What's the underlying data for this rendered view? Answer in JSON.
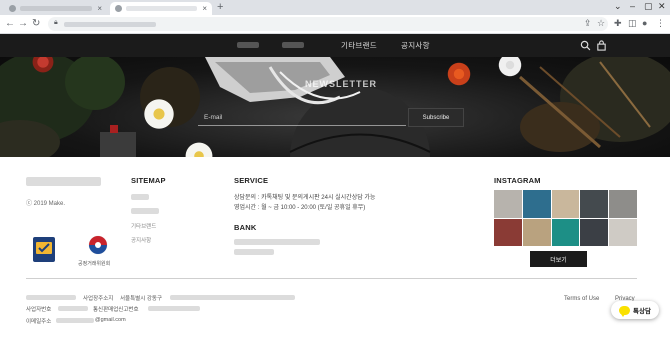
{
  "browser": {
    "tabs": [
      {
        "state": "inactive"
      },
      {
        "state": "active"
      }
    ],
    "new_tab_symbol": "+",
    "close_symbol": "×"
  },
  "header": {
    "menu": [
      "기타브랜드",
      "공지사항"
    ],
    "icons": [
      "search-icon",
      "bag-icon"
    ],
    "background": "#1b1b1b"
  },
  "hero": {
    "newsletter_title": "NEWSLETTER",
    "email_placeholder": "E-mail",
    "subscribe_label": "Subscribe"
  },
  "footer": {
    "copyright": "ⓒ 2019 Make.",
    "sitemap": {
      "title": "SITEMAP",
      "links": [
        "기타브랜드",
        "공지사항"
      ]
    },
    "service": {
      "title": "SERVICE",
      "lines": [
        "상담문의 : 카톡채팅 및 문의게시판 24시 실시간상담 가능",
        "영업시간 : 월 ~ 금 10:00 - 20:00 (토/일 공휴일 휴무)"
      ]
    },
    "bank": {
      "title": "BANK"
    },
    "instagram": {
      "title": "INSTAGRAM",
      "more_label": "더보기",
      "tiles": [
        "#b7b3ad",
        "#2e6e8e",
        "#c9b79c",
        "#444a4e",
        "#8e8d8a",
        "#8a3b35",
        "#b9a27f",
        "#1d8f86",
        "#3b3f45",
        "#cfcbc5"
      ]
    },
    "business_info": {
      "line1_labels": [
        "사업장주소지",
        "서울특별시 강동구"
      ],
      "line2_labels": [
        "사업자번호",
        "통신판매업신고번호"
      ],
      "line3_label": "이메일주소",
      "email_suffix": "@gmail.com"
    },
    "links": [
      "Terms of Use",
      "Privacy"
    ],
    "fair_trade_label": "공정거래위원회",
    "talk_label": "톡상담"
  }
}
